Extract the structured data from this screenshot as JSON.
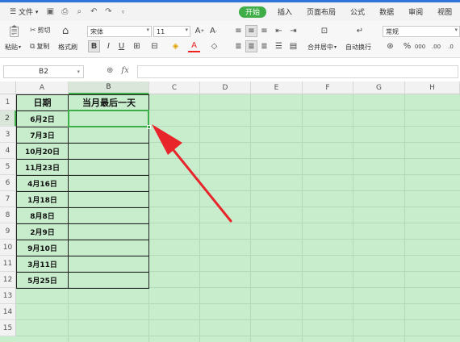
{
  "menubar": {
    "file_label": "文件",
    "tabs": [
      "开始",
      "插入",
      "页面布局",
      "公式",
      "数据",
      "审阅",
      "视图"
    ],
    "active_tab": "开始"
  },
  "ribbon": {
    "paste": "粘贴",
    "cut": "剪切",
    "copy": "复制",
    "format_painter": "格式刷",
    "font_name": "宋体",
    "font_size": "11",
    "merge_center": "合并居中",
    "wrap_text": "自动换行",
    "number_format": "常规"
  },
  "formula_bar": {
    "name_box": "B2",
    "fx_label": "fx",
    "formula": ""
  },
  "grid": {
    "columns": [
      "A",
      "B",
      "C",
      "D",
      "E",
      "F",
      "G",
      "H"
    ],
    "rows": [
      "1",
      "2",
      "3",
      "4",
      "5",
      "6",
      "7",
      "8",
      "9",
      "10",
      "11",
      "12",
      "13",
      "14",
      "15"
    ],
    "header_a": "日期",
    "header_b": "当月最后一天",
    "dates": [
      "6月2日",
      "7月3日",
      "10月20日",
      "11月23日",
      "4月16日",
      "1月18日",
      "8月8日",
      "2月9日",
      "9月10日",
      "3月11日",
      "5月25日"
    ],
    "selected_cell": "B2"
  },
  "colors": {
    "accent": "#3fae49",
    "sheet_bg": "#c7edcc",
    "arrow": "#e8252a",
    "top_border": "#2f75d8"
  }
}
